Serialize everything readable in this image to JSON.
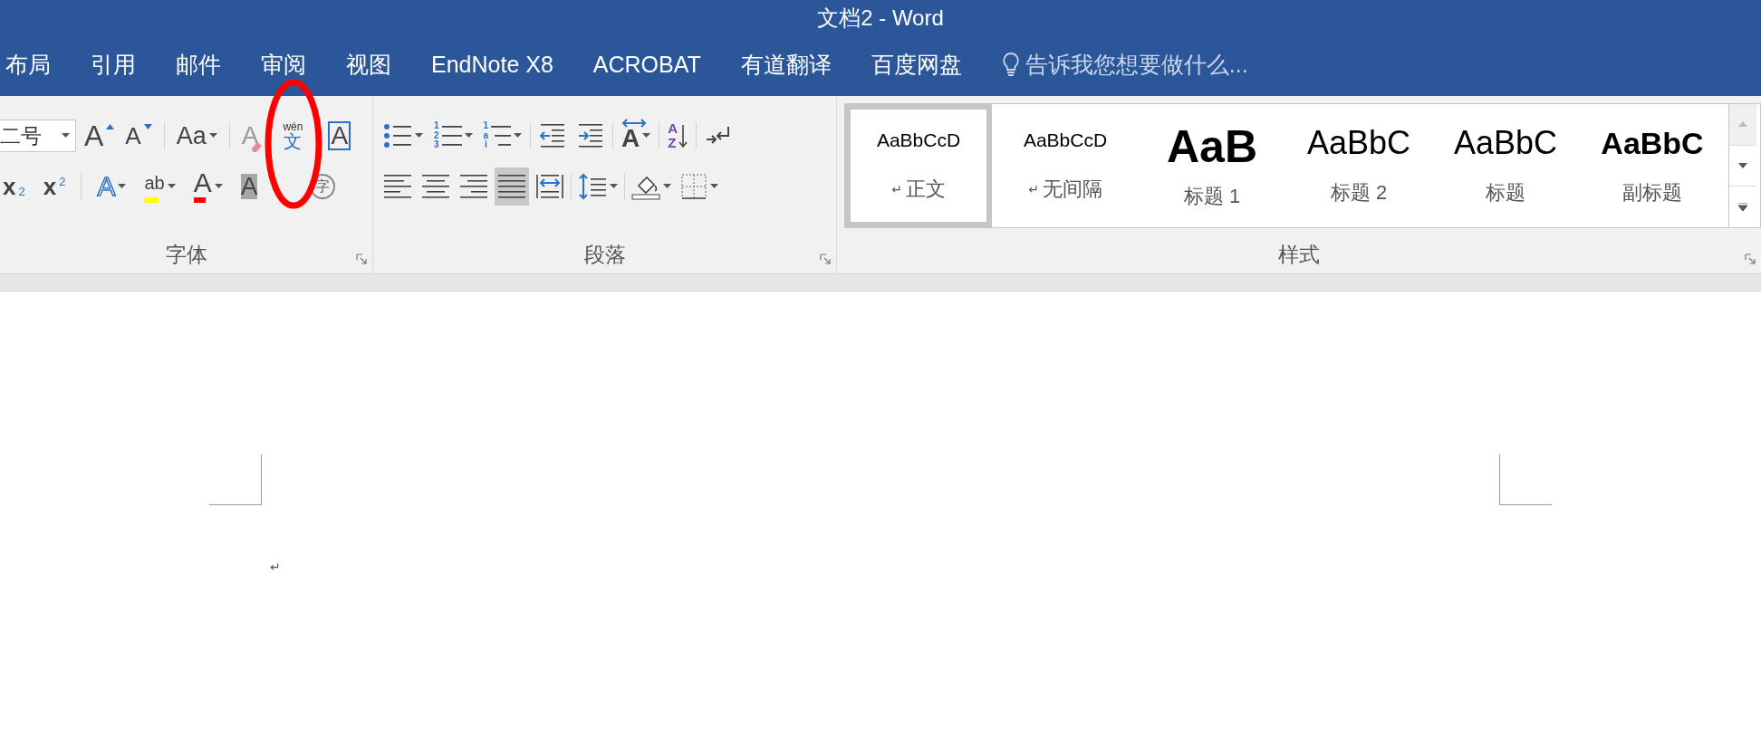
{
  "window": {
    "title": "文档2 - Word"
  },
  "tabs": [
    {
      "label": "布局",
      "selected": false
    },
    {
      "label": "引用",
      "selected": false
    },
    {
      "label": "邮件",
      "selected": false
    },
    {
      "label": "审阅",
      "selected": false
    },
    {
      "label": "视图",
      "selected": false
    },
    {
      "label": "EndNote X8",
      "selected": false
    },
    {
      "label": "ACROBAT",
      "selected": false
    },
    {
      "label": "有道翻译",
      "selected": false
    },
    {
      "label": "百度网盘",
      "selected": false
    }
  ],
  "tell_me": {
    "placeholder": "告诉我您想要做什么..."
  },
  "font_group": {
    "label": "字体",
    "size_value": "二号",
    "row1": [
      {
        "kind": "grow",
        "glyph": "A"
      },
      {
        "kind": "shrink",
        "glyph": "A"
      },
      {
        "kind": "case",
        "glyph": "Aa"
      },
      {
        "kind": "clear",
        "glyph": "A"
      },
      {
        "kind": "phonetic",
        "glyph": "文",
        "ruby": "wén"
      },
      {
        "kind": "border",
        "glyph": "A"
      }
    ],
    "row2": [
      {
        "kind": "sub",
        "glyph": "x",
        "script": "2"
      },
      {
        "kind": "sup",
        "glyph": "x",
        "script": "2"
      },
      {
        "kind": "effects",
        "glyph": "A"
      },
      {
        "kind": "highlight",
        "glyph": "ab",
        "color": "#ffff00"
      },
      {
        "kind": "fontcolor",
        "glyph": "A",
        "color": "#ff0000"
      },
      {
        "kind": "shading",
        "glyph": "A"
      },
      {
        "kind": "enclose",
        "glyph": "字"
      }
    ]
  },
  "paragraph_group": {
    "label": "段落",
    "row1": [
      {
        "kind": "bullets"
      },
      {
        "kind": "numbering",
        "glyph": "123"
      },
      {
        "kind": "multilevel",
        "glyph": "1ai"
      },
      {
        "kind": "outdent"
      },
      {
        "kind": "indent"
      },
      {
        "kind": "direction",
        "glyph": "A"
      },
      {
        "kind": "sort",
        "glyph": "AZ"
      },
      {
        "kind": "marks"
      }
    ],
    "alignment": [
      {
        "kind": "left",
        "selected": false
      },
      {
        "kind": "center",
        "selected": false
      },
      {
        "kind": "right",
        "selected": false
      },
      {
        "kind": "justify",
        "selected": true
      },
      {
        "kind": "distribute",
        "selected": false
      }
    ],
    "row2": [
      {
        "kind": "spacing"
      },
      {
        "kind": "fill"
      },
      {
        "kind": "borders"
      }
    ]
  },
  "styles_group": {
    "label": "样式",
    "items": [
      {
        "kind": "normal",
        "sample": "AaBbCcD",
        "mark": "↵",
        "label": "正文",
        "selected": true
      },
      {
        "kind": "normal",
        "sample": "AaBbCcD",
        "mark": "↵",
        "label": "无间隔",
        "selected": false
      },
      {
        "kind": "h1",
        "sample": "AaB",
        "label": "标题 1",
        "selected": false
      },
      {
        "kind": "h2",
        "sample": "AaBbC",
        "label": "标题 2",
        "selected": false
      },
      {
        "kind": "title",
        "sample": "AaBbC",
        "label": "标题",
        "selected": false
      },
      {
        "kind": "subtitle",
        "sample": "AaBbC",
        "label": "副标题",
        "selected": false
      }
    ]
  },
  "document": {
    "paragraph_mark": "↵"
  }
}
